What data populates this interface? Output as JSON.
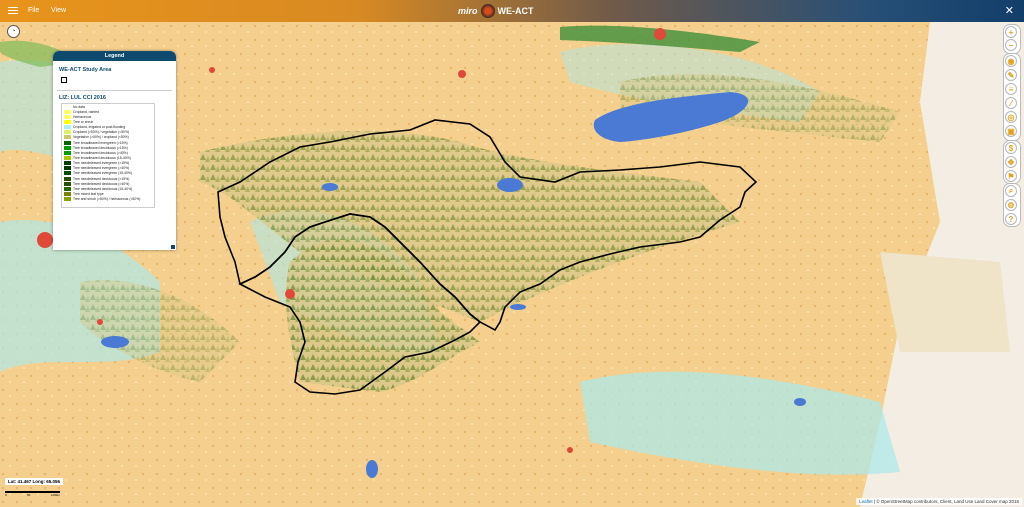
{
  "app": {
    "menu": {
      "file": "File",
      "view": "View"
    },
    "brand": {
      "logo_text": "miro",
      "title": "WE-ACT"
    }
  },
  "legend": {
    "header": "Legend",
    "study_area_title": "WE-ACT Study Area",
    "lul_title": "LIZ: LUL CCI 2016",
    "items": [
      {
        "label": "No data",
        "color": "#ffffff"
      },
      {
        "label": "Cropland, rainfed",
        "color": "#ffff64"
      },
      {
        "label": "Herbaceous",
        "color": "#ffff64"
      },
      {
        "label": "Tree or shrub",
        "color": "#ffff00"
      },
      {
        "label": "Cropland, irrigated or post-flooding",
        "color": "#aaf0f0"
      },
      {
        "label": "Cropland (>50%) / vegetation (<50%)",
        "color": "#dcf064"
      },
      {
        "label": "Vegetation (>50%) / cropland (<50%)",
        "color": "#c8c864"
      },
      {
        "label": "Tree broadleaved evergreen (>15%)",
        "color": "#006400"
      },
      {
        "label": "Tree broadleaved deciduous (>15%)",
        "color": "#00a000"
      },
      {
        "label": "Tree broadleaved deciduous (>40%)",
        "color": "#00a000"
      },
      {
        "label": "Tree broadleaved deciduous (15-40%)",
        "color": "#aac800"
      },
      {
        "label": "Tree needleleaved evergreen (>15%)",
        "color": "#003c00"
      },
      {
        "label": "Tree needleleaved evergreen (>40%)",
        "color": "#003c00"
      },
      {
        "label": "Tree needleleaved evergreen (15-40%)",
        "color": "#005000"
      },
      {
        "label": "Tree needleleaved deciduous (>15%)",
        "color": "#285000"
      },
      {
        "label": "Tree needleleaved deciduous (>40%)",
        "color": "#285000"
      },
      {
        "label": "Tree needleleaved deciduous (15-40%)",
        "color": "#286400"
      },
      {
        "label": "Tree mixed leaf type",
        "color": "#788200"
      },
      {
        "label": "Tree and shrub (>50%) / herbaceous (<50%)",
        "color": "#8ca000"
      }
    ]
  },
  "map": {
    "coords": "Lat: 41.467 Long: 65.056",
    "scale_labels": [
      "0",
      "50",
      "100km"
    ],
    "attribution_leaflet": "Leaflet",
    "attribution_rest": "| © OpenStreetMap contributors, Client, Land Use Land Cover map 2016",
    "colors": {
      "desert": "#f5cf8d",
      "water": "#4a7ad4",
      "irrigated": "#aee8e8",
      "urban": "#e0493a",
      "forest": "#6f8a3a"
    }
  },
  "controls": {
    "zoom_in": "+",
    "zoom_out": "−",
    "compass": "◔"
  }
}
